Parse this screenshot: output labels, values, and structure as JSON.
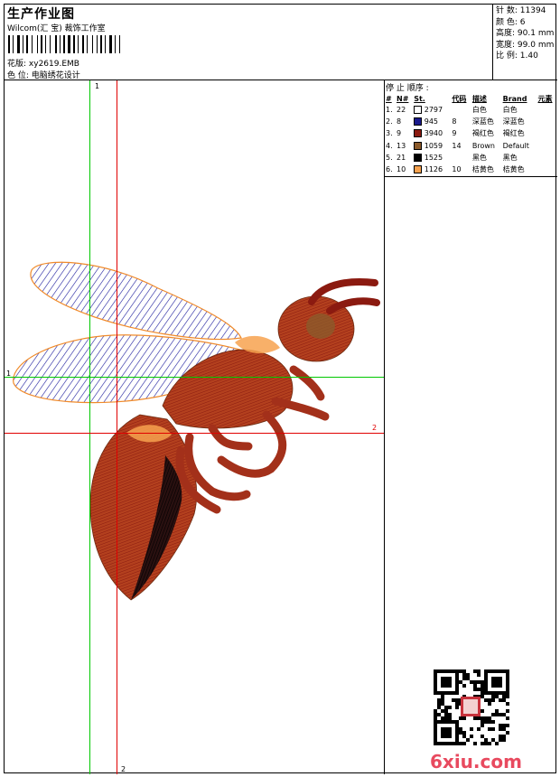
{
  "header": {
    "title": "生产作业图",
    "company": "Wilcom(汇 宝) 裁饰工作室",
    "design_label": "花版:",
    "design_file": "xy2619.EMB",
    "position_label": "色 位:",
    "position_value": "电脑绣花设计"
  },
  "specs": [
    {
      "label": "针 数:",
      "value": "11394"
    },
    {
      "label": "颜 色:",
      "value": "6"
    },
    {
      "label": "高度:",
      "value": "90.1 mm"
    },
    {
      "label": "宽度:",
      "value": "99.0 mm"
    },
    {
      "label": "比 例:",
      "value": "1.40"
    }
  ],
  "stop_sequence": {
    "title": "停 止 顺序 :",
    "headers": [
      "#",
      "N#",
      "St.",
      "代码",
      "描述",
      "Brand",
      "元素"
    ],
    "rows": [
      {
        "idx": "1.",
        "n": "22",
        "color": "#ffffff",
        "st": "2797",
        "code": "",
        "desc": "白色",
        "brand": "白色"
      },
      {
        "idx": "2.",
        "n": "8",
        "color": "#1a1a8c",
        "st": "945",
        "code": "8",
        "desc": "深蓝色",
        "brand": "深蓝色"
      },
      {
        "idx": "3.",
        "n": "9",
        "color": "#8b1a10",
        "st": "3940",
        "code": "9",
        "desc": "褐红色",
        "brand": "褐红色"
      },
      {
        "idx": "4.",
        "n": "13",
        "color": "#8b5a2b",
        "st": "1059",
        "code": "14",
        "desc": "Brown",
        "brand": "Default"
      },
      {
        "idx": "5.",
        "n": "21",
        "color": "#000000",
        "st": "1525",
        "code": "",
        "desc": "黑色",
        "brand": "黑色"
      },
      {
        "idx": "6.",
        "n": "10",
        "color": "#f7a24f",
        "st": "1126",
        "code": "10",
        "desc": "桔黄色",
        "brand": "桔黄色"
      }
    ]
  },
  "axes": {
    "v1_top": "1",
    "h1_left": "1",
    "h2_right": "2",
    "v2_bottom": "2"
  },
  "watermark": "6xiu.com"
}
